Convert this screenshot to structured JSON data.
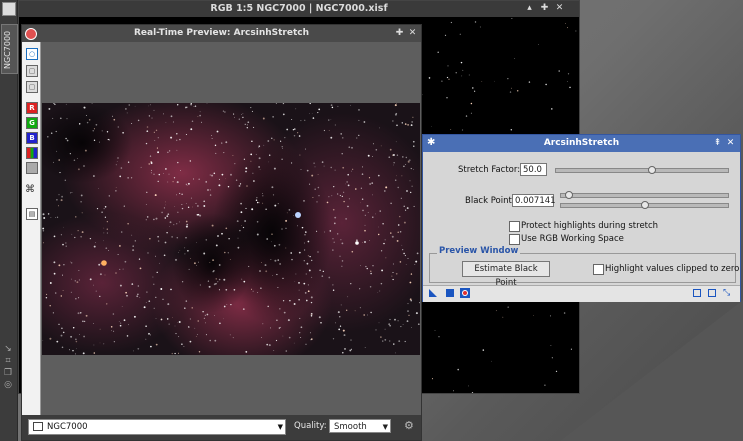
{
  "image_window": {
    "title": "RGB 1:5 NGC7000 | NGC7000.xisf"
  },
  "left_dock": {
    "tab_label": "NGC7000"
  },
  "preview": {
    "title": "Real-Time Preview: ArcsinhStretch",
    "toolbar": {
      "channel_r": "R",
      "channel_g": "G",
      "channel_b": "B"
    },
    "view_select": "NGC7000",
    "quality_label": "Quality:",
    "quality_value": "Smooth"
  },
  "dialog": {
    "title": "ArcsinhStretch",
    "stretch_label": "Stretch Factor:",
    "stretch_value": "50.0",
    "stretch_slider_fraction": 0.56,
    "black_label": "Black Point:",
    "black_value": "0.007141",
    "black_coarse_fraction": 0.05,
    "black_fine_fraction": 0.5,
    "protect_label": "Protect highlights during stretch",
    "protect_checked": false,
    "rgbws_label": "Use RGB Working Space",
    "rgbws_checked": false,
    "group_title": "Preview Window",
    "estimate_button": "Estimate Black Point",
    "clip_label": "Highlight values clipped to zero",
    "clip_checked": false
  },
  "colors": {
    "dialog_title": "#4a6fb5",
    "group_title": "#2a55a8",
    "nebula": "#8a2f4a"
  },
  "icons": [
    "close-icon",
    "pin-icon",
    "gear-icon",
    "camera-icon",
    "new-instance-icon",
    "apply-icon",
    "realtime-preview-icon",
    "reset-icon"
  ]
}
